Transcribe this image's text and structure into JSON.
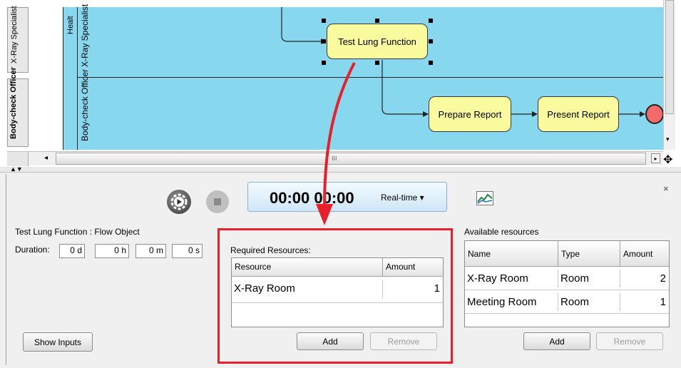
{
  "lanes": {
    "pool_label": "Healt",
    "xray_lane": "X-Ray Specialist",
    "body_lane": "Body-check Officer"
  },
  "left_tabs": {
    "tab1": "X-Ray Specialist",
    "tab2": "Body-check Officer"
  },
  "tasks": {
    "test_lung": "Test Lung Function",
    "prepare_report": "Prepare Report",
    "present_report": "Present Report"
  },
  "scrollbar": {
    "grip": "III"
  },
  "simulation": {
    "time": "00:00 00:00",
    "mode": "Real-time ▾"
  },
  "flow_object": {
    "legend": "Test Lung Function : Flow Object",
    "duration_label": "Duration:",
    "days": "0",
    "days_unit": "d",
    "hours": "0",
    "hours_unit": "h",
    "minutes": "0",
    "minutes_unit": "m",
    "seconds": "0",
    "seconds_unit": "s",
    "show_inputs": "Show Inputs"
  },
  "required": {
    "title": "Required Resources:",
    "col_resource": "Resource",
    "col_amount": "Amount",
    "rows": [
      {
        "resource": "X-Ray Room",
        "amount": "1"
      }
    ],
    "add": "Add",
    "remove": "Remove"
  },
  "available": {
    "legend": "Available resources",
    "col_name": "Name",
    "col_type": "Type",
    "col_amount": "Amount",
    "rows": [
      {
        "name": "X-Ray Room",
        "type": "Room",
        "amount": "2"
      },
      {
        "name": "Meeting Room",
        "type": "Room",
        "amount": "1"
      }
    ],
    "add": "Add",
    "remove": "Remove"
  },
  "colors": {
    "pool": "#87d7ef",
    "task": "#fafa9e",
    "highlight": "#e8202a",
    "end_event": "#f46a6a"
  },
  "icons": [
    "play-gear-icon",
    "stop-icon",
    "chart-icon",
    "close-icon",
    "move-icon"
  ]
}
